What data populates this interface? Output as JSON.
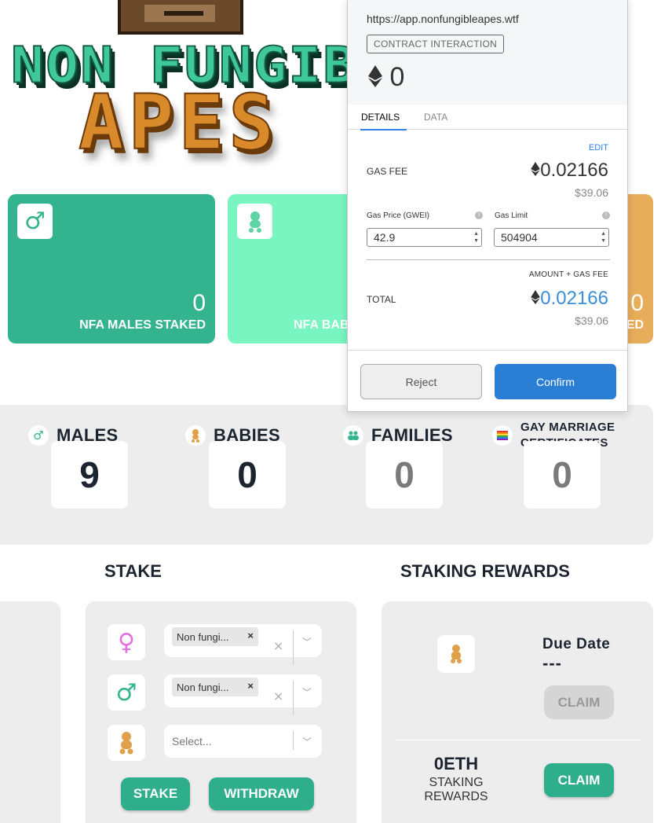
{
  "logo": {
    "line1": "NON FUNGIB",
    "line2": "APES"
  },
  "cards": {
    "males": {
      "icon": "male-icon",
      "value": "0",
      "label": "NFA MALES STAKED"
    },
    "babies": {
      "icon": "baby-icon",
      "value": "",
      "label": "NFA BAB"
    },
    "partial": {
      "value": "0",
      "label": "ED"
    }
  },
  "counts": {
    "males": {
      "icon": "male-icon",
      "title": "MALES",
      "value": "9"
    },
    "babies": {
      "icon": "baby-icon",
      "title": "BABIES",
      "value": "0"
    },
    "families": {
      "icon": "family-icon",
      "title": "FAMILIES",
      "value": "0"
    },
    "certificates": {
      "icon": "rainbow-flag-icon",
      "title_line1": "GAY MARRIAGE",
      "title_line2": "CERTIFICATES",
      "value": "0"
    }
  },
  "stake": {
    "title": "STAKE",
    "rows": [
      {
        "icon": "female-icon",
        "chip": "Non fungi...",
        "placeholder": ""
      },
      {
        "icon": "male-icon",
        "chip": "Non fungi...",
        "placeholder": ""
      },
      {
        "icon": "baby-icon",
        "chip": "",
        "placeholder": "Select..."
      }
    ],
    "stake_button": "STAKE",
    "withdraw_button": "WITHDRAW"
  },
  "rewards": {
    "title": "STAKING REWARDS",
    "due_label": "Due Date",
    "due_value": "---",
    "claim_disabled": "CLAIM",
    "eth_amount": "0ETH",
    "eth_caption_line1": "STAKING",
    "eth_caption_line2": "REWARDS",
    "claim_button": "CLAIM"
  },
  "wallet": {
    "origin": "https://app.nonfungibleapes.wtf",
    "badge": "CONTRACT INTERACTION",
    "amount": "0",
    "tabs": [
      "DETAILS",
      "DATA"
    ],
    "edit": "EDIT",
    "gas_fee_label": "GAS FEE",
    "gas_fee_eth": "0.02166",
    "gas_fee_usd": "$39.06",
    "gas_price_label": "Gas Price (GWEI)",
    "gas_price_value": "42.9",
    "gas_limit_label": "Gas Limit",
    "gas_limit_value": "504904",
    "amount_gas_label": "AMOUNT + GAS FEE",
    "total_label": "TOTAL",
    "total_eth": "0.02166",
    "total_usd": "$39.06",
    "reject": "Reject",
    "confirm": "Confirm"
  },
  "colors": {
    "males_card": "#34b48e",
    "babies_card": "#79f5c1",
    "partial_card": "#e8ad5b",
    "green_button": "#2fae8c",
    "confirm_blue": "#2a7ed4",
    "total_blue": "#3a8ed8",
    "female_pink": "#e46fe0",
    "baby_orange": "#e0a14a"
  }
}
